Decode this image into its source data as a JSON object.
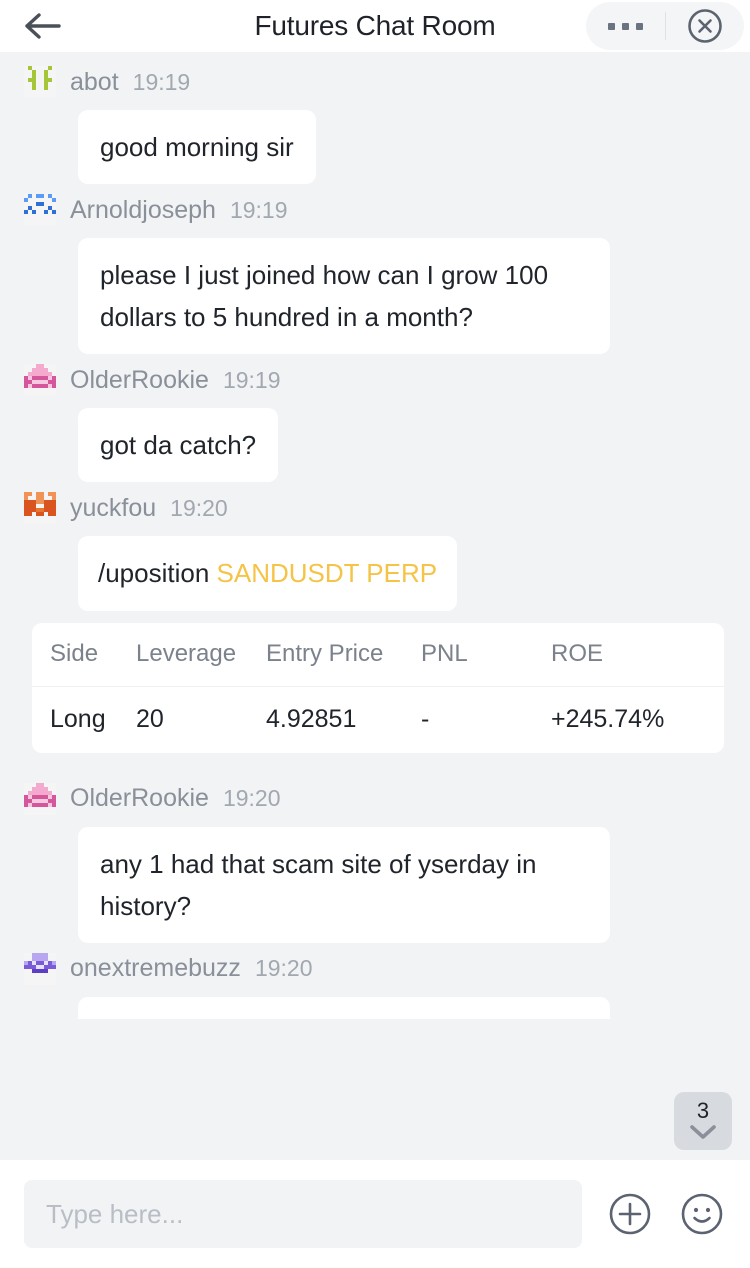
{
  "header": {
    "back_icon": "arrow-left-icon",
    "title": "Futures Chat Room",
    "more_icon": "more-dots-icon",
    "close_icon": "close-circle-icon"
  },
  "colors": {
    "page_bg": "#f2f3f5",
    "bubble_bg": "#ffffff",
    "accent_yellow": "#f5c346",
    "roe_green": "#35a86b",
    "username_gray": "#8a9099",
    "time_gray": "#a2a8b0"
  },
  "messages": [
    {
      "user": "abot",
      "time": "19:19",
      "avatar_name": "avatar-abot",
      "avatar_color": "#a6c63a",
      "text": "good morning sir"
    },
    {
      "user": "Arnoldjoseph",
      "time": "19:19",
      "avatar_name": "avatar-arnoldjoseph",
      "avatar_color": "#4a86e8",
      "text": "please I just joined how can I grow 100 dollars to 5 hundred in a month?"
    },
    {
      "user": "OlderRookie",
      "time": "19:19",
      "avatar_name": "avatar-olderrookie",
      "avatar_color": "#d6569b",
      "text": "got da catch?"
    },
    {
      "user": "yuckfou",
      "time": "19:20",
      "avatar_name": "avatar-yuckfou",
      "avatar_color": "#d9541e",
      "command_prefix": "/uposition ",
      "command_symbol": "SANDUSDT PERP"
    },
    {
      "user": "OlderRookie",
      "time": "19:20",
      "avatar_name": "avatar-olderrookie",
      "avatar_color": "#d6569b",
      "text": "any 1 had that scam site of yserday in history?"
    },
    {
      "user": "onextremebuzz",
      "time": "19:20",
      "avatar_name": "avatar-onextremebuzz",
      "avatar_color": "#7a5cd8",
      "text": ""
    }
  ],
  "position_table": {
    "columns": [
      "Side",
      "Leverage",
      "Entry Price",
      "PNL",
      "ROE"
    ],
    "rows": [
      {
        "side": "Long",
        "leverage": "20",
        "entry_price": "4.92851",
        "pnl": "-",
        "roe": "+245.74%"
      }
    ]
  },
  "scroll_badge": {
    "count": "3",
    "icon": "chevron-down-icon"
  },
  "composer": {
    "placeholder": "Type here...",
    "value": "",
    "add_icon": "plus-circle-icon",
    "emoji_icon": "smiley-icon"
  }
}
